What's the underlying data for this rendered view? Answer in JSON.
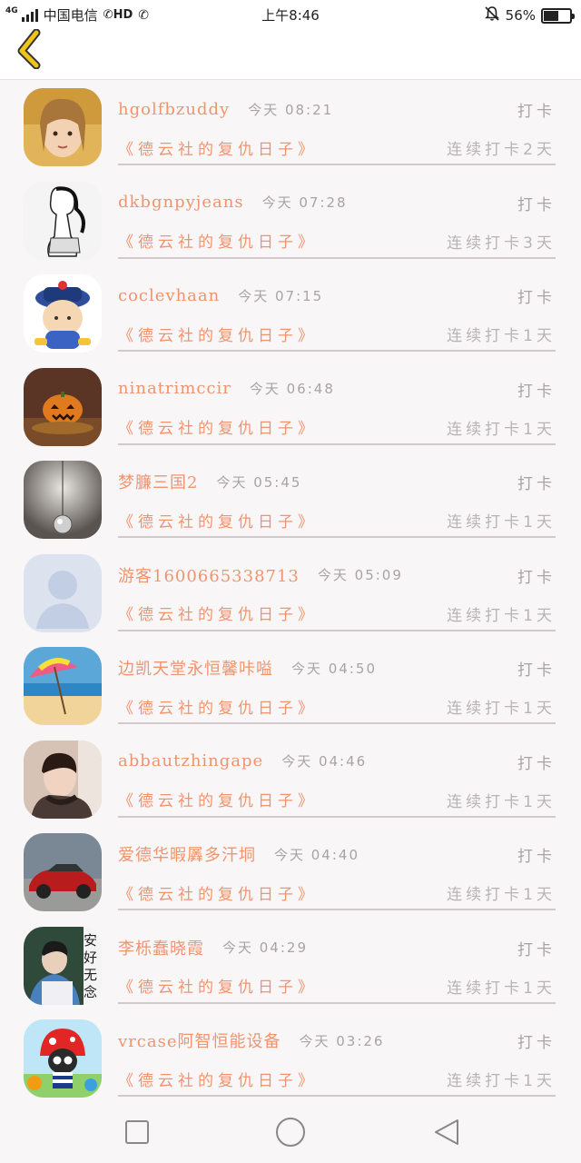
{
  "status_bar": {
    "network": "4G",
    "carrier": "中国电信",
    "hd": "HD",
    "time": "上午8:46",
    "battery_text": "56%",
    "battery_level": 0.56
  },
  "header": {
    "back_icon": "chevron-left-icon",
    "accent_color": "#f0c419"
  },
  "colors": {
    "name": "#f0946e",
    "meta": "#a8a4a6",
    "background": "#f8f6f7"
  },
  "list": {
    "items": [
      {
        "name": "hgolfbzuddy",
        "time": "今天 08:21",
        "action": "打卡",
        "book": "《德云社的复仇日子》",
        "streak": "连续打卡2天",
        "avatar": "avatar-girl-photo"
      },
      {
        "name": "dkbgnpyjeans",
        "time": "今天 07:28",
        "action": "打卡",
        "book": "《德云社的复仇日子》",
        "streak": "连续打卡3天",
        "avatar": "avatar-sketch-girl"
      },
      {
        "name": "coclevhaan",
        "time": "今天 07:15",
        "action": "打卡",
        "book": "《德云社的复仇日子》",
        "streak": "连续打卡1天",
        "avatar": "avatar-cartoon-official"
      },
      {
        "name": "ninatrimccir",
        "time": "今天 06:48",
        "action": "打卡",
        "book": "《德云社的复仇日子》",
        "streak": "连续打卡1天",
        "avatar": "avatar-pumpkin"
      },
      {
        "name": "梦臁三国2",
        "time": "今天 05:45",
        "action": "打卡",
        "book": "《德云社的复仇日子》",
        "streak": "连续打卡1天",
        "avatar": "avatar-pendulum"
      },
      {
        "name": "游客1600665338713",
        "time": "今天 05:09",
        "action": "打卡",
        "book": "《德云社的复仇日子》",
        "streak": "连续打卡1天",
        "avatar": "avatar-default-user"
      },
      {
        "name": "边凯天堂永恒馨咔嗌",
        "time": "今天 04:50",
        "action": "打卡",
        "book": "《德云社的复仇日子》",
        "streak": "连续打卡1天",
        "avatar": "avatar-beach-umbrella"
      },
      {
        "name": "abbautzhingape",
        "time": "今天 04:46",
        "action": "打卡",
        "book": "《德云社的复仇日子》",
        "streak": "连续打卡1天",
        "avatar": "avatar-boy-photo"
      },
      {
        "name": "爱德华暇羼多汗垌",
        "time": "今天 04:40",
        "action": "打卡",
        "book": "《德云社的复仇日子》",
        "streak": "连续打卡1天",
        "avatar": "avatar-red-car"
      },
      {
        "name": "李栎蠢晓霞",
        "time": "今天 04:29",
        "action": "打卡",
        "book": "《德云社的复仇日子》",
        "streak": "连续打卡1天",
        "avatar": "avatar-anfu-wunian",
        "avatar_text": "安好无念"
      },
      {
        "name": "vrcase阿智恒能设备",
        "time": "今天 03:26",
        "action": "打卡",
        "book": "《德云社的复仇日子》",
        "streak": "连续打卡1天",
        "avatar": "avatar-cartoon-mushroom"
      }
    ]
  },
  "nav": {
    "recent": "square-icon",
    "home": "circle-icon",
    "back": "triangle-back-icon"
  }
}
